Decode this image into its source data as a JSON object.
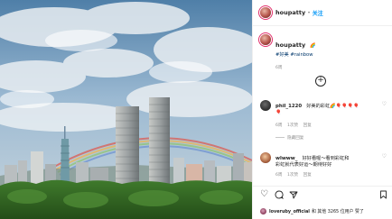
{
  "post": {
    "username": "houpatty",
    "follow_label": "关注",
    "more_label": "•••",
    "caption_username": "houpatty",
    "caption_text": "🌈",
    "caption_line2": "#好美 #rainbow",
    "caption_time": "6周"
  },
  "comments": [
    {
      "username": "phil_1220",
      "text": "好美的彩虹🌈🎈🎈🎈🎈",
      "text2": "🎈",
      "time": "6周",
      "likes": "1次赞",
      "reply": "回复",
      "view_replies": "隐藏回复"
    },
    {
      "username": "wlwww_",
      "text": "好好看喔～看到彩虹和",
      "text2": "彩虹就代表好运～期待好好",
      "time": "6周",
      "likes": "1次赞",
      "reply": "回复"
    }
  ],
  "likes": {
    "liker": "loveruby_official",
    "and_label": "和 其他 3265 位用户 赞了"
  },
  "icons": {
    "add": "plus-circle-icon",
    "heart": "heart-outline-icon",
    "comment": "comment-icon",
    "share": "share-icon",
    "save": "bookmark-icon"
  },
  "colors": {
    "follow": "#0095f6",
    "meta": "#8e8e8e",
    "text": "#262626"
  }
}
